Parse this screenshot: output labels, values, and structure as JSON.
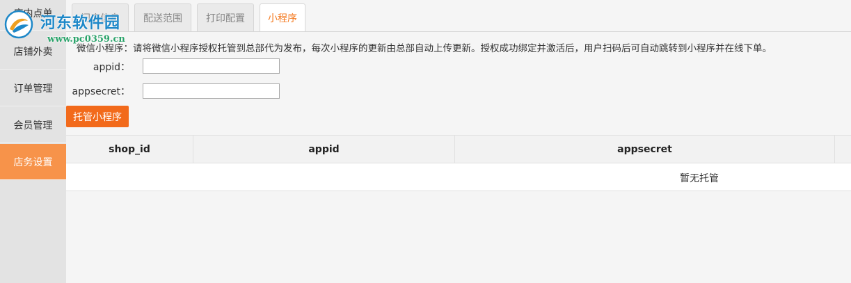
{
  "sidebar": {
    "items": [
      {
        "label": "店内点单",
        "active": false
      },
      {
        "label": "店铺外卖",
        "active": false
      },
      {
        "label": "订单管理",
        "active": false
      },
      {
        "label": "会员管理",
        "active": false
      },
      {
        "label": "店务设置",
        "active": true
      }
    ]
  },
  "watermark": {
    "title": "河东软件园",
    "url": "www.pc0359.cn"
  },
  "tabs": [
    {
      "label": "门店信息",
      "active": false
    },
    {
      "label": "配送范围",
      "active": false
    },
    {
      "label": "打印配置",
      "active": false
    },
    {
      "label": "小程序",
      "active": true
    }
  ],
  "form": {
    "notice": "微信小程序：请将微信小程序授权托管到总部代为发布，每次小程序的更新由总部自动上传更新。授权成功绑定并激活后，用户扫码后可自动跳转到小程序并在线下单。",
    "appid_label": "appid：",
    "appid_value": "",
    "appsecret_label": "appsecret：",
    "appsecret_value": "",
    "submit_label": "托管小程序"
  },
  "table": {
    "columns": [
      "shop_id",
      "appid",
      "appsecret",
      ""
    ],
    "empty_text": "暂无托管"
  },
  "colors": {
    "accent": "#f26a1b",
    "sidebar_active": "#f7934a",
    "tab_active_text": "#f47a20"
  }
}
